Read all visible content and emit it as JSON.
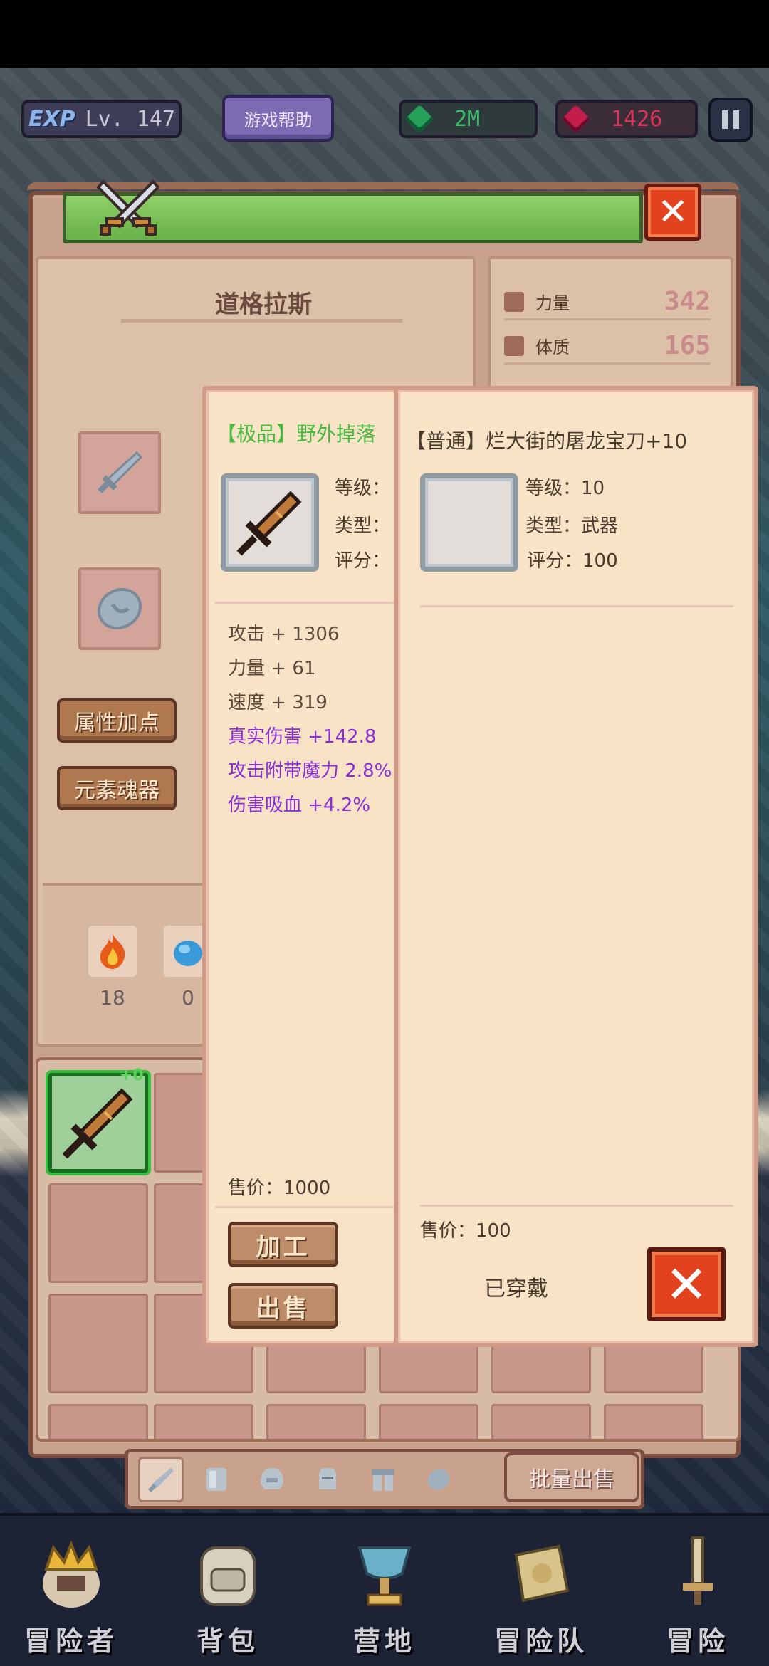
{
  "hud": {
    "exp_badge": "EXP",
    "level": "Lv. 147",
    "help_label": "游戏帮助",
    "gem_value": "2M",
    "ruby_value": "1426"
  },
  "character": {
    "name": "道格拉斯",
    "attr_button": "属性加点",
    "soul_button": "元素魂器",
    "elements": [
      {
        "icon": "fire-element-icon",
        "count": "18"
      },
      {
        "icon": "water-element-icon",
        "count": "0"
      }
    ]
  },
  "stats": [
    {
      "label": "力量",
      "value": "342"
    },
    {
      "label": "体质",
      "value": "165"
    }
  ],
  "inventory": {
    "first_item_plus": "+0",
    "batch_sell_label": "批量出售"
  },
  "popup_left": {
    "title": "【极品】野外掉落",
    "level_label": "等级：",
    "type_label": "类型：",
    "score_label": "评分：",
    "stats": [
      {
        "text": "攻击 + 1306",
        "kind": "normal"
      },
      {
        "text": "力量 + 61",
        "kind": "normal"
      },
      {
        "text": "速度 + 319",
        "kind": "normal"
      },
      {
        "text": "真实伤害 +142.8",
        "kind": "magic"
      },
      {
        "text": "攻击附带魔力 2.8%",
        "kind": "magic"
      },
      {
        "text": "伤害吸血 +4.2%",
        "kind": "magic"
      }
    ],
    "price": "售价：1000",
    "craft_label": "加工",
    "sell_label": "出售"
  },
  "popup_right": {
    "title": "【普通】烂大街的屠龙宝刀+10",
    "level": "等级：10",
    "type": "类型：武器",
    "score": "评分：100",
    "price": "售价：100",
    "equipped_label": "已穿戴"
  },
  "nav": [
    {
      "label": "冒险者",
      "icon": "adventurer-crown-icon"
    },
    {
      "label": "背包",
      "icon": "backpack-icon"
    },
    {
      "label": "营地",
      "icon": "camp-trophy-icon"
    },
    {
      "label": "冒险队",
      "icon": "team-book-icon"
    },
    {
      "label": "冒险",
      "icon": "adventure-sword-icon"
    }
  ],
  "colors": {
    "accent_green": "#48b93f",
    "magic_purple": "#8a2fd5",
    "close_red": "#e2421d"
  }
}
